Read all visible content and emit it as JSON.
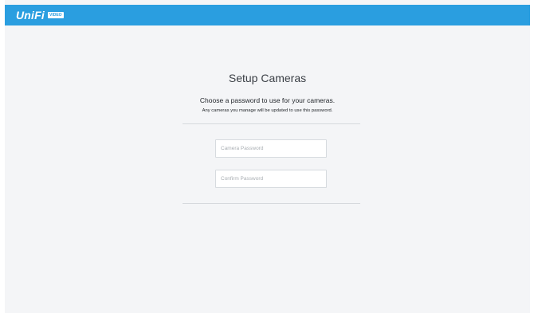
{
  "header": {
    "brand": "UniFi",
    "badge": "VIDEO"
  },
  "setup": {
    "title": "Setup Cameras",
    "subtitle": "Choose a password to use for your cameras.",
    "note": "Any cameras you manage will be updated to use this password.",
    "password_placeholder": "Camera Password",
    "confirm_placeholder": "Confirm Password"
  },
  "colors": {
    "topbar": "#2a9ee0",
    "background": "#f4f5f7",
    "field_border": "#d7dbdf"
  }
}
